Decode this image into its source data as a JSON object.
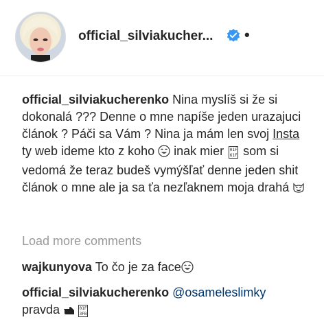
{
  "header": {
    "username": "official_silviakucher...",
    "verified_icon": "verified-badge-icon",
    "more_icon": "more-dot-icon",
    "accent": "#3897f0"
  },
  "caption": {
    "username": "official_silviakucherenko",
    "text_part1": " Nina myslíš si že si dokonalá ??? Denne o mne napíše jeden urazajuci článok ? Páči sa Vám ? Nina ja mám len svoj ",
    "insta_link": "Insta",
    "text_part2": " ty web ideme kto z koho ",
    "text_part3": " inak mier ",
    "text_part4": " som si vedomá že teraz budeš vymýšľať denne jeden shit článok o mne ale ja sa ťa nezľaknem moja drahá ",
    "box_glyph_1": "01F 61F"
  },
  "load_more": "Load more comments",
  "comments": [
    {
      "username": "wajkunyova",
      "text": " To čo je za face"
    },
    {
      "username": "official_silviakucherenko",
      "mention": "@osameleslimky",
      "text": "pravda ",
      "box_glyph": "01F 3FB"
    }
  ]
}
